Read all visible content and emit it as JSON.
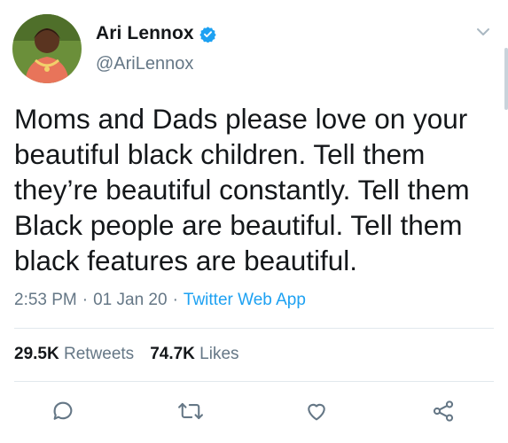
{
  "user": {
    "display_name": "Ari Lennox",
    "handle": "@AriLennox",
    "verified": true,
    "avatar_icon": "profile-photo"
  },
  "tweet": {
    "text": "Moms and Dads please love on your\nbeautiful black children. Tell them\nthey’re beautiful constantly. Tell them\nBlack people are beautiful. Tell them\nblack features are beautiful."
  },
  "meta": {
    "time": "2:53 PM",
    "separator": "·",
    "date": "01 Jan 20",
    "source": "Twitter Web App"
  },
  "stats": {
    "retweets_count": "29.5K",
    "retweets_label": "Retweets",
    "likes_count": "74.7K",
    "likes_label": "Likes"
  },
  "actions": {
    "reply_icon": "comment-icon",
    "retweet_icon": "retweet-icon",
    "like_icon": "heart-icon",
    "share_icon": "share-icon"
  },
  "colors": {
    "accent": "#1da1f2",
    "text": "#14171a",
    "secondary": "#657786",
    "divider": "#e1e8ed"
  }
}
